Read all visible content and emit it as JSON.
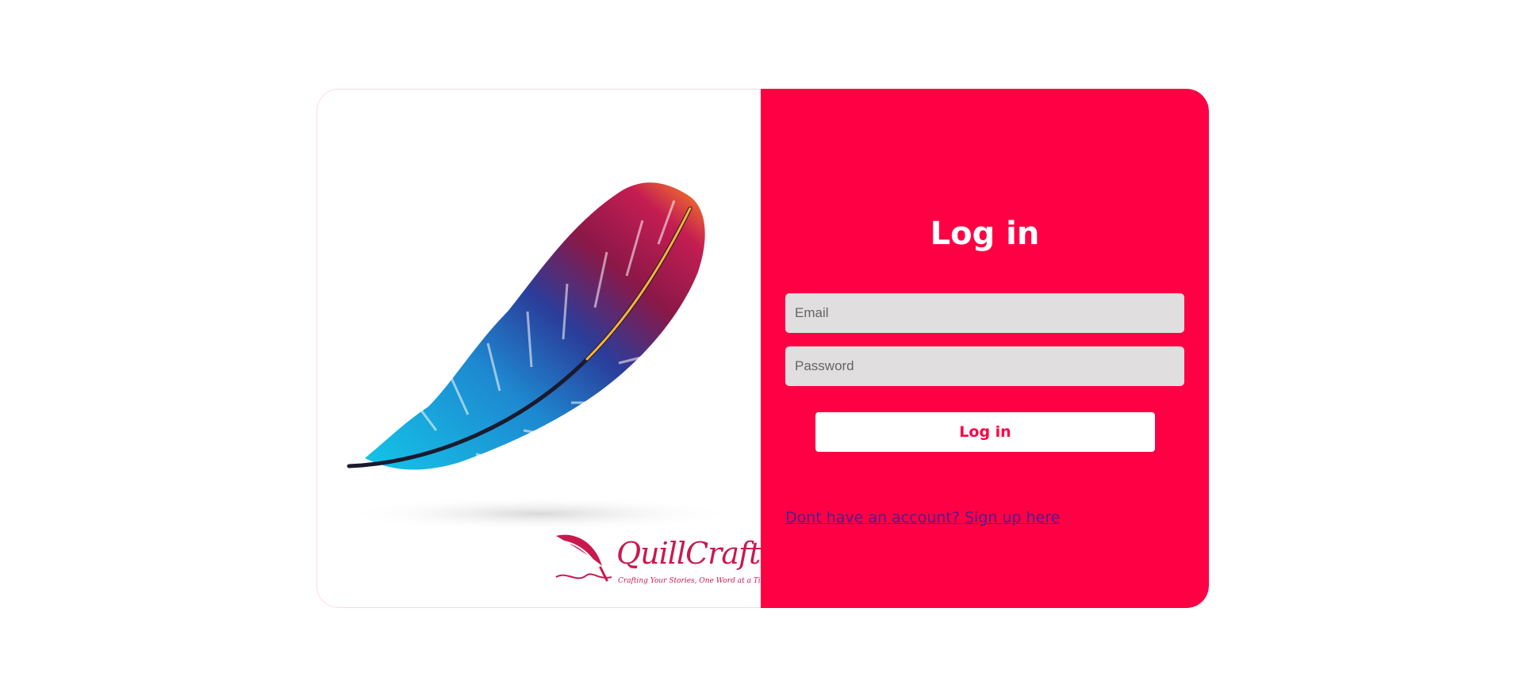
{
  "login_form": {
    "title": "Log in",
    "email_placeholder": "Email",
    "password_placeholder": "Password",
    "submit_label": "Log in",
    "signup_link": "Dont have an account? Sign up here"
  },
  "branding": {
    "logo_name": "QuillCraft",
    "logo_tagline": "Crafting Your Stories, One Word at a Tim",
    "feather_icon": "feather-illustration",
    "logo_icon": "quill-icon"
  },
  "colors": {
    "accent": "#ff0044",
    "field_background": "#e0dedf",
    "link": "#551a8b",
    "logo": "#c8194f"
  }
}
